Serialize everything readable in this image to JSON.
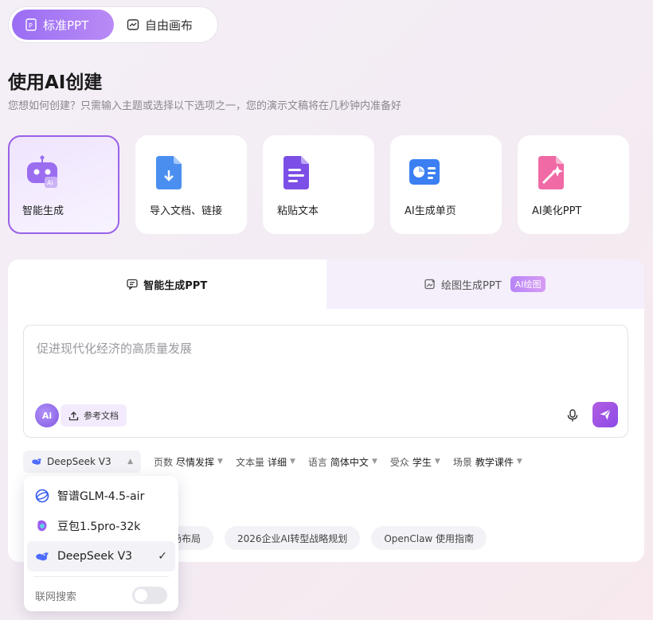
{
  "mode_toggle": {
    "standard": "标准PPT",
    "canvas": "自由画布"
  },
  "header": {
    "title": "使用AI创建",
    "subtitle": "您想如何创建？只需输入主题或选择以下选项之一，您的演示文稿将在几秒钟内准备好"
  },
  "cards": [
    {
      "label": "智能生成",
      "icon": "robot-icon"
    },
    {
      "label": "导入文档、链接",
      "icon": "import-doc-icon"
    },
    {
      "label": "粘贴文本",
      "icon": "paste-text-icon"
    },
    {
      "label": "AI生成单页",
      "icon": "single-page-icon"
    },
    {
      "label": "AI美化PPT",
      "icon": "beautify-icon"
    }
  ],
  "tabs": {
    "smart": "智能生成PPT",
    "draw": "绘图生成PPT",
    "draw_badge": "AI绘图"
  },
  "prompt": {
    "placeholder": "促进现代化经济的高质量发展",
    "ai_badge": "Ai",
    "ref_doc": "参考文档"
  },
  "options": {
    "model": "DeepSeek V3",
    "pages_label": "页数",
    "pages_value": "尽情发挥",
    "text_label": "文本量",
    "text_value": "详细",
    "lang_label": "语言",
    "lang_value": "简体中文",
    "audience_label": "受众",
    "audience_value": "学生",
    "scene_label": "场景",
    "scene_value": "教学课件"
  },
  "chips": [
    "场布局",
    "2026企业AI转型战略规划",
    "OpenClaw 使用指南"
  ],
  "dropdown": {
    "items": [
      {
        "label": "智谱GLM-4.5-air",
        "icon": "glm-icon"
      },
      {
        "label": "豆包1.5pro-32k",
        "icon": "doubao-icon"
      },
      {
        "label": "DeepSeek V3",
        "icon": "deepseek-icon",
        "selected": true
      }
    ],
    "web_search_label": "联网搜索",
    "web_search_on": false
  },
  "colors": {
    "accent": "#9a62e8"
  }
}
